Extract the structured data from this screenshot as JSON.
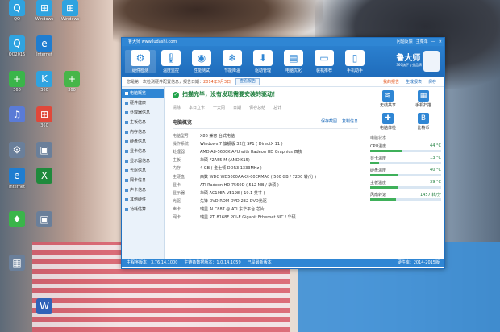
{
  "desktop": {
    "icons": [
      {
        "label": "QQ",
        "glyph": "Q",
        "color": "#2fa3e0"
      },
      {
        "label": "Windows",
        "glyph": "⊞",
        "color": "#2fa3e0"
      },
      {
        "label": "Windows",
        "glyph": "⊞",
        "color": "#2fa3e0"
      },
      {
        "label": "QQ2015",
        "glyph": "Q",
        "color": "#2fa3e0"
      },
      {
        "label": "Internet",
        "glyph": "e",
        "color": "#1f7dd0"
      },
      {
        "label": "360",
        "glyph": "+",
        "color": "#3ab54a"
      },
      {
        "label": "360",
        "glyph": "K",
        "color": "#2fa3e0"
      },
      {
        "label": "360",
        "glyph": "+",
        "color": "#46b649"
      },
      {
        "label": "",
        "glyph": "♫",
        "color": "#5a7bd6"
      },
      {
        "label": "360",
        "glyph": "⊞",
        "color": "#e0483a"
      },
      {
        "label": "",
        "glyph": "⚙",
        "color": "#6a7f9a"
      },
      {
        "label": "",
        "glyph": "▣",
        "color": "#6a7f9a"
      },
      {
        "label": "Internet",
        "glyph": "e",
        "color": "#1f7dd0"
      },
      {
        "label": "",
        "glyph": "X",
        "color": "#1f8a3c"
      },
      {
        "label": "",
        "glyph": "♦",
        "color": "#3ab54a"
      },
      {
        "label": "",
        "glyph": "▣",
        "color": "#6a7f9a"
      },
      {
        "label": "",
        "glyph": "▦",
        "color": "#6a7f9a"
      },
      {
        "label": "",
        "glyph": "W",
        "color": "#2f62b8"
      }
    ]
  },
  "window": {
    "title": "鲁大师 www.ludashi.com",
    "controls": [
      "问题反馈",
      "主菜单",
      "—",
      "✕"
    ],
    "toolbar": [
      {
        "label": "硬件检测",
        "glyph": "⚙",
        "active": true
      },
      {
        "label": "温度监控",
        "glyph": "🌡"
      },
      {
        "label": "性能测试",
        "glyph": "◉"
      },
      {
        "label": "节能降温",
        "glyph": "❄"
      },
      {
        "label": "驱动管理",
        "glyph": "⬇"
      },
      {
        "label": "电脑优化",
        "glyph": "▤"
      },
      {
        "label": "装机推荐",
        "glyph": "▭"
      },
      {
        "label": "手机助手",
        "glyph": "▯"
      }
    ],
    "logo": {
      "name": "鲁大师",
      "sub": "360旗下专业品牌"
    },
    "notice": {
      "text": "您是第一次检测硬件配置信息，报告日期：",
      "date": "2014年9月3日",
      "button": "查看报告",
      "links": [
        "我的报告",
        "生成报表",
        "保存"
      ]
    },
    "sidebar": [
      {
        "label": "电脑概览",
        "active": true
      },
      {
        "label": "硬件健康"
      },
      {
        "label": "处理器信息"
      },
      {
        "label": "主板信息"
      },
      {
        "label": "内存信息"
      },
      {
        "label": "硬盘信息"
      },
      {
        "label": "显卡信息"
      },
      {
        "label": "显示器信息"
      },
      {
        "label": "光驱信息"
      },
      {
        "label": "网卡信息"
      },
      {
        "label": "声卡信息"
      },
      {
        "label": "其他硬件"
      },
      {
        "label": "功耗估算"
      }
    ],
    "main": {
      "scan_message": "扫描完毕，没有发现需要安装的驱动！",
      "tabs": [
        "清除",
        "本日立卡",
        "一天同",
        "日期",
        "保存总结",
        "总计"
      ],
      "overview_title": "电脑概览",
      "overview_links": [
        "保存截图",
        "复制信息"
      ],
      "info": [
        {
          "key": "电脑型号",
          "value": "X86 兼容 台式电脑"
        },
        {
          "key": "操作系统",
          "value": "Windows 7 旗舰版 32位 SP1 ( DirectX 11 )"
        },
        {
          "key": "处理器",
          "value": "AMD A8-5600K APU with Radeon HD Graphics 四核"
        },
        {
          "key": "主板",
          "value": "华硕 F2A55-M (AMD K15)"
        },
        {
          "key": "内存",
          "value": "4 GB ( 金士顿 DDR3 1333MHz )"
        },
        {
          "key": "主硬盘",
          "value": "西数 WDC WD5000AAKX-00ERMA0 ( 500 GB / 7200 转/分 )"
        },
        {
          "key": "显卡",
          "value": "ATI Radeon HD 7560D ( 512 MB / 华硕 )"
        },
        {
          "key": "显示器",
          "value": "华硕 AC19EA VE198 ( 19.1 英寸 )"
        },
        {
          "key": "光驱",
          "value": "先锋 DVD-ROM DVD-232 DVD光驱"
        },
        {
          "key": "声卡",
          "value": "瑞昱 ALC887 @ ATI 东华平台 芯片"
        },
        {
          "key": "网卡",
          "value": "瑞昱 RTL8168F PCI-E Gigabit Ethernet NIC / 华硕"
        }
      ]
    },
    "rightpanel": {
      "quick": [
        {
          "label": "无线共享",
          "glyph": "≋"
        },
        {
          "label": "手机扫描",
          "glyph": "▦"
        },
        {
          "label": "电脑体检",
          "glyph": "✚"
        },
        {
          "label": "比特币",
          "glyph": "B"
        }
      ],
      "status_title": "电脑状态",
      "meters": [
        {
          "label": "CPU温度",
          "value": "44 °C",
          "level": 0.44
        },
        {
          "label": "显卡温度",
          "value": "13 °C",
          "level": 0.13
        },
        {
          "label": "硬盘温度",
          "value": "40 °C",
          "level": 0.4
        },
        {
          "label": "主板温度",
          "value": "39 °C",
          "level": 0.39
        },
        {
          "label": "风扇转速",
          "value": "1457 转/分",
          "level": 0.36
        }
      ]
    },
    "statusbar": {
      "left": "主程序版本：3.76.14.1000",
      "mid": "主链备数据版本：1.0.14.1059",
      "right": "已是最新版本",
      "far_right": "硬件库：2014-2015版"
    }
  }
}
